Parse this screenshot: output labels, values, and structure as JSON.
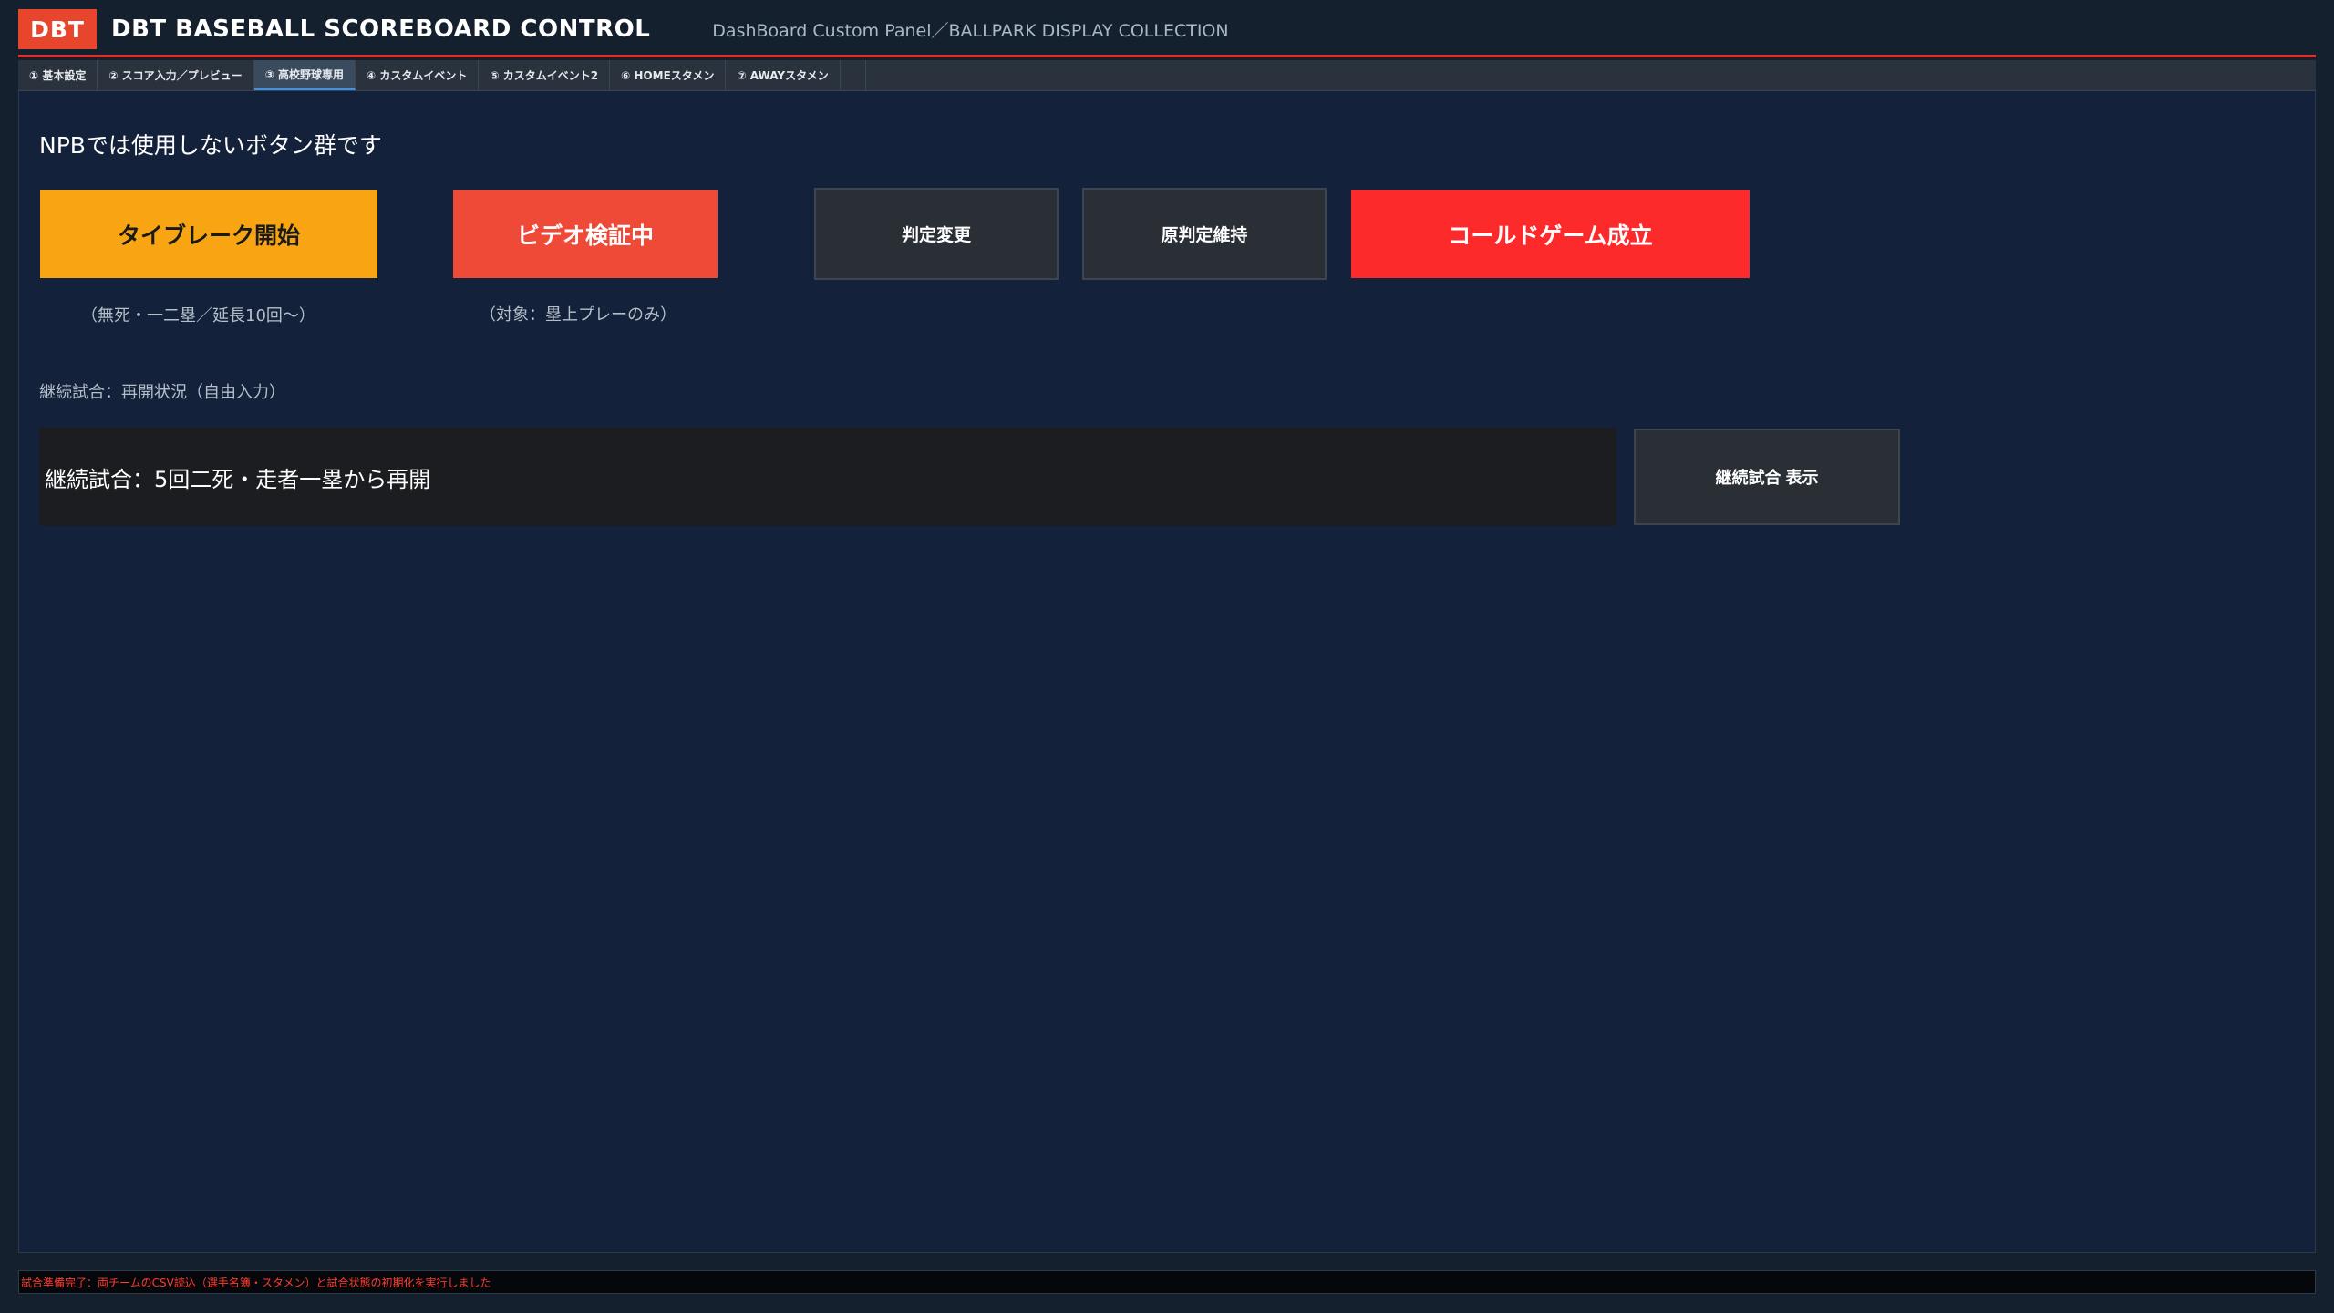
{
  "header": {
    "logo_text": "DBT",
    "title": "DBT BASEBALL SCOREBOARD CONTROL",
    "subtitle": "DashBoard Custom Panel／BALLPARK DISPLAY COLLECTION"
  },
  "tabs": [
    {
      "label": "① 基本設定",
      "active": false
    },
    {
      "label": "② スコア入力／プレビュー",
      "active": false
    },
    {
      "label": "③ 高校野球専用",
      "active": true
    },
    {
      "label": "④ カスタムイベント",
      "active": false
    },
    {
      "label": "⑤ カスタムイベント2",
      "active": false
    },
    {
      "label": "⑥ HOMEスタメン",
      "active": false
    },
    {
      "label": "⑦ AWAYスタメン",
      "active": false
    }
  ],
  "main": {
    "section_title": "NPBでは使用しないボタン群です",
    "buttons": {
      "tiebreak": "タイブレーク開始",
      "video_review": "ビデオ検証中",
      "call_changed": "判定変更",
      "call_upheld": "原判定維持",
      "called_game": "コールドゲーム成立",
      "resume_display": "継続試合 表示"
    },
    "notes": {
      "tiebreak": "（無死・一二塁／延長10回〜）",
      "video_review": "（対象：塁上プレーのみ）"
    },
    "resume_label": "継続試合：再開状況（自由入力）",
    "resume_value": "継続試合：5回二死・走者一塁から再開"
  },
  "status": {
    "message": "試合準備完了：両チームのCSV読込（選手名簿・スタメン）と試合状態の初期化を実行しました"
  },
  "colors": {
    "accent_red": "#e8452d",
    "tiebreak_orange": "#f9a412",
    "video_red": "#ee4a37",
    "called_red": "#fd2a2c",
    "panel_bg": "#13213a"
  }
}
